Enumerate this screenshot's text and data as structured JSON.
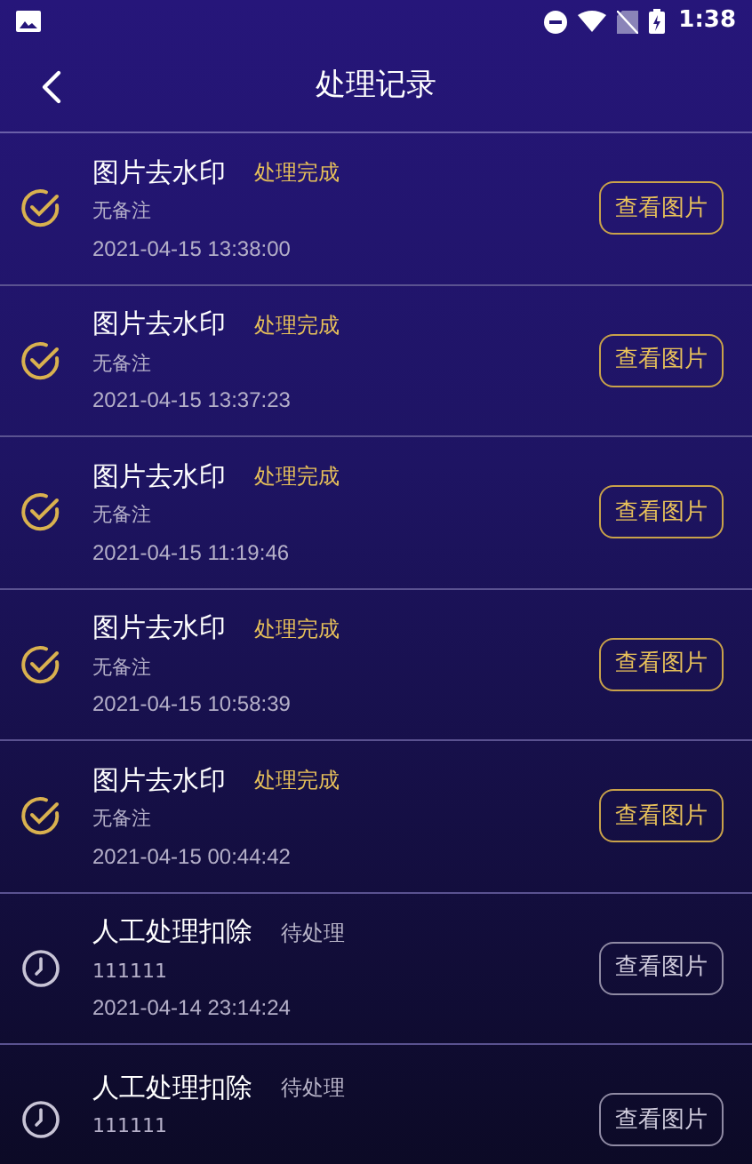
{
  "status_bar": {
    "time": "1:38"
  },
  "header": {
    "title": "处理记录"
  },
  "records": [
    {
      "kind": "done",
      "title": "图片去水印",
      "status": "处理完成",
      "note": "无备注",
      "time": "2021-04-15 13:38:00",
      "button": "查看图片"
    },
    {
      "kind": "done",
      "title": "图片去水印",
      "status": "处理完成",
      "note": "无备注",
      "time": "2021-04-15 13:37:23",
      "button": "查看图片"
    },
    {
      "kind": "done",
      "title": "图片去水印",
      "status": "处理完成",
      "note": "无备注",
      "time": "2021-04-15 11:19:46",
      "button": "查看图片"
    },
    {
      "kind": "done",
      "title": "图片去水印",
      "status": "处理完成",
      "note": "无备注",
      "time": "2021-04-15 10:58:39",
      "button": "查看图片"
    },
    {
      "kind": "done",
      "title": "图片去水印",
      "status": "处理完成",
      "note": "无备注",
      "time": "2021-04-15 00:44:42",
      "button": "查看图片"
    },
    {
      "kind": "pending",
      "title": "人工处理扣除",
      "status": "待处理",
      "note": "111111",
      "time": "2021-04-14 23:14:24",
      "button": "查看图片"
    },
    {
      "kind": "pending",
      "title": "人工处理扣除",
      "status": "待处理",
      "note": "111111",
      "button": "查看图片"
    }
  ]
}
